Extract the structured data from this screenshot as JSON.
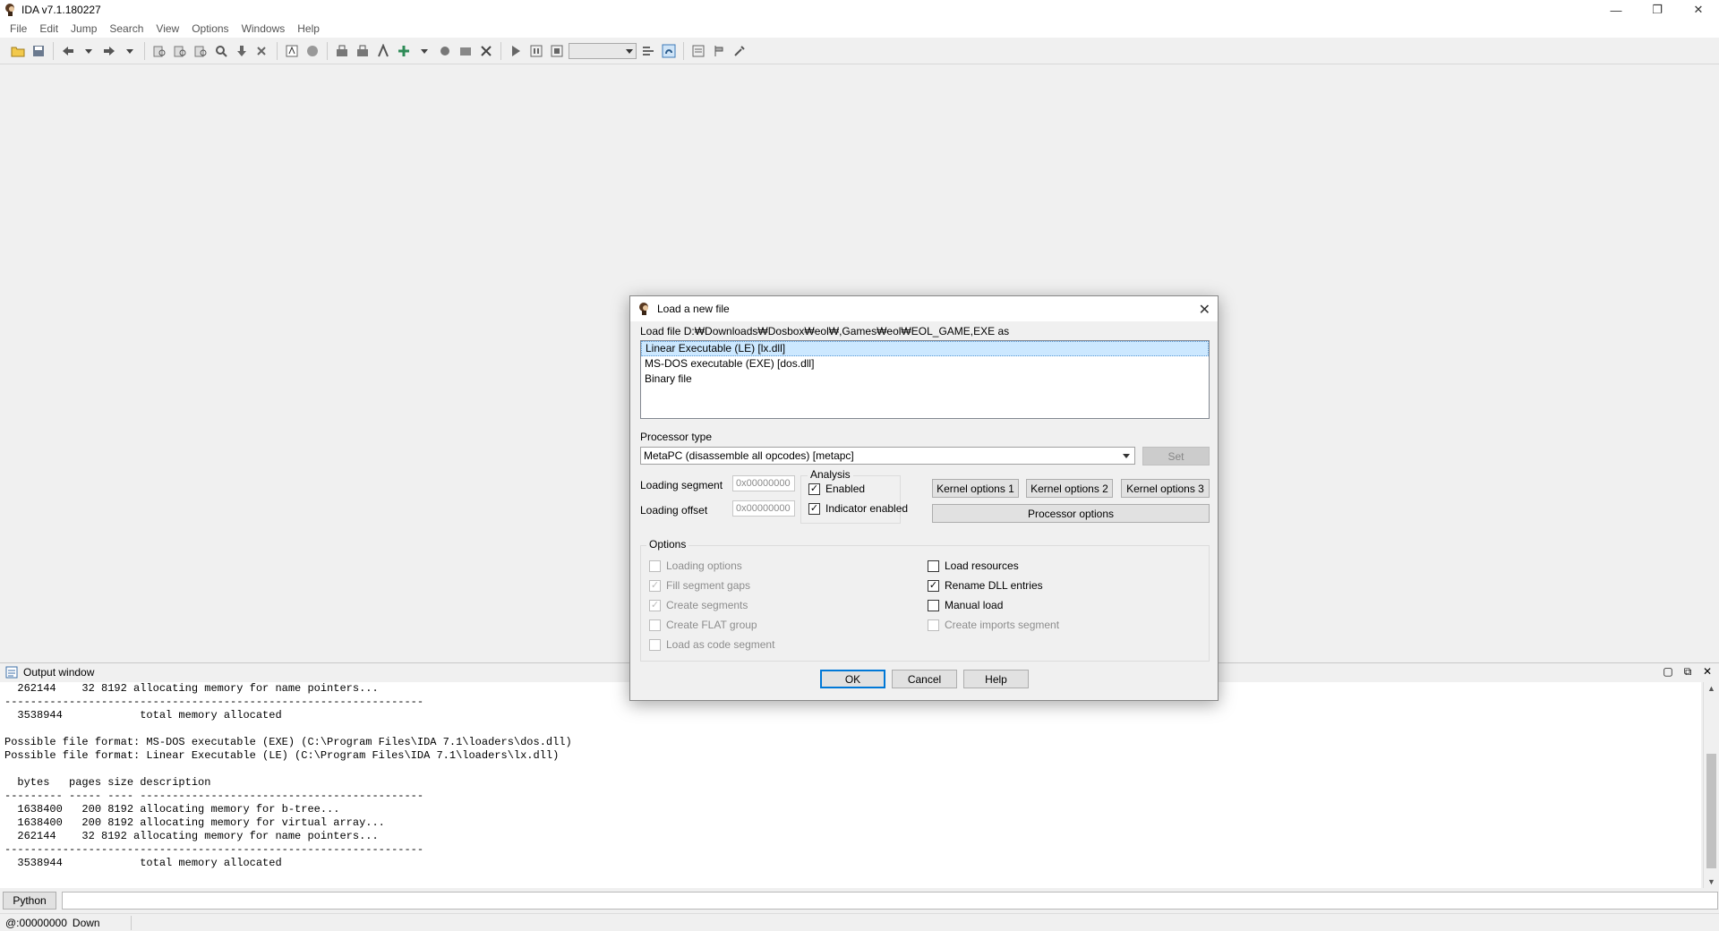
{
  "app": {
    "title": "IDA v7.1.180227",
    "minimize": "—",
    "restore": "❐",
    "close": "✕"
  },
  "menu": [
    "File",
    "Edit",
    "Jump",
    "Search",
    "View",
    "Options",
    "Windows",
    "Help"
  ],
  "dialog": {
    "title": "Load a new file",
    "close": "✕",
    "load_label": "Load file D:₩Downloads₩Dosbox₩eol₩,Games₩eol₩EOL_GAME,EXE as",
    "formats": [
      "Linear Executable (LE) [lx.dll]",
      "MS-DOS executable (EXE) [dos.dll]",
      "Binary file"
    ],
    "processor_type_label": "Processor type",
    "processor_value": "MetaPC (disassemble all opcodes) [metapc]",
    "set_button": "Set",
    "loading_segment_label": "Loading segment",
    "loading_segment_value": "0x00000000",
    "loading_offset_label": "Loading offset",
    "loading_offset_value": "0x00000000",
    "analysis_title": "Analysis",
    "analysis_enabled": "Enabled",
    "analysis_indicator": "Indicator enabled",
    "kernel_options_1": "Kernel options 1",
    "kernel_options_2": "Kernel options 2",
    "kernel_options_3": "Kernel options 3",
    "processor_options": "Processor options",
    "options_title": "Options",
    "opt_loading_options": "Loading options",
    "opt_fill_segment_gaps": "Fill segment gaps",
    "opt_create_segments": "Create segments",
    "opt_create_flat_group": "Create FLAT group",
    "opt_load_as_code_segment": "Load as code segment",
    "opt_load_resources": "Load resources",
    "opt_rename_dll_entries": "Rename DLL entries",
    "opt_manual_load": "Manual load",
    "opt_create_imports_segment": "Create imports segment",
    "ok": "OK",
    "cancel": "Cancel",
    "help": "Help"
  },
  "output": {
    "title": "Output window",
    "text": "  262144    32 8192 allocating memory for name pointers...\n-----------------------------------------------------------------\n  3538944            total memory allocated\n\nPossible file format: MS-DOS executable (EXE) (C:\\Program Files\\IDA 7.1\\loaders\\dos.dll)\nPossible file format: Linear Executable (LE) (C:\\Program Files\\IDA 7.1\\loaders\\lx.dll)\n\n  bytes   pages size description\n--------- ----- ---- --------------------------------------------\n  1638400   200 8192 allocating memory for b-tree...\n  1638400   200 8192 allocating memory for virtual array...\n  262144    32 8192 allocating memory for name pointers...\n-----------------------------------------------------------------\n  3538944            total memory allocated"
  },
  "cmdline": {
    "python_button": "Python"
  },
  "status": {
    "address": "@:00000000",
    "direction": "Down"
  }
}
